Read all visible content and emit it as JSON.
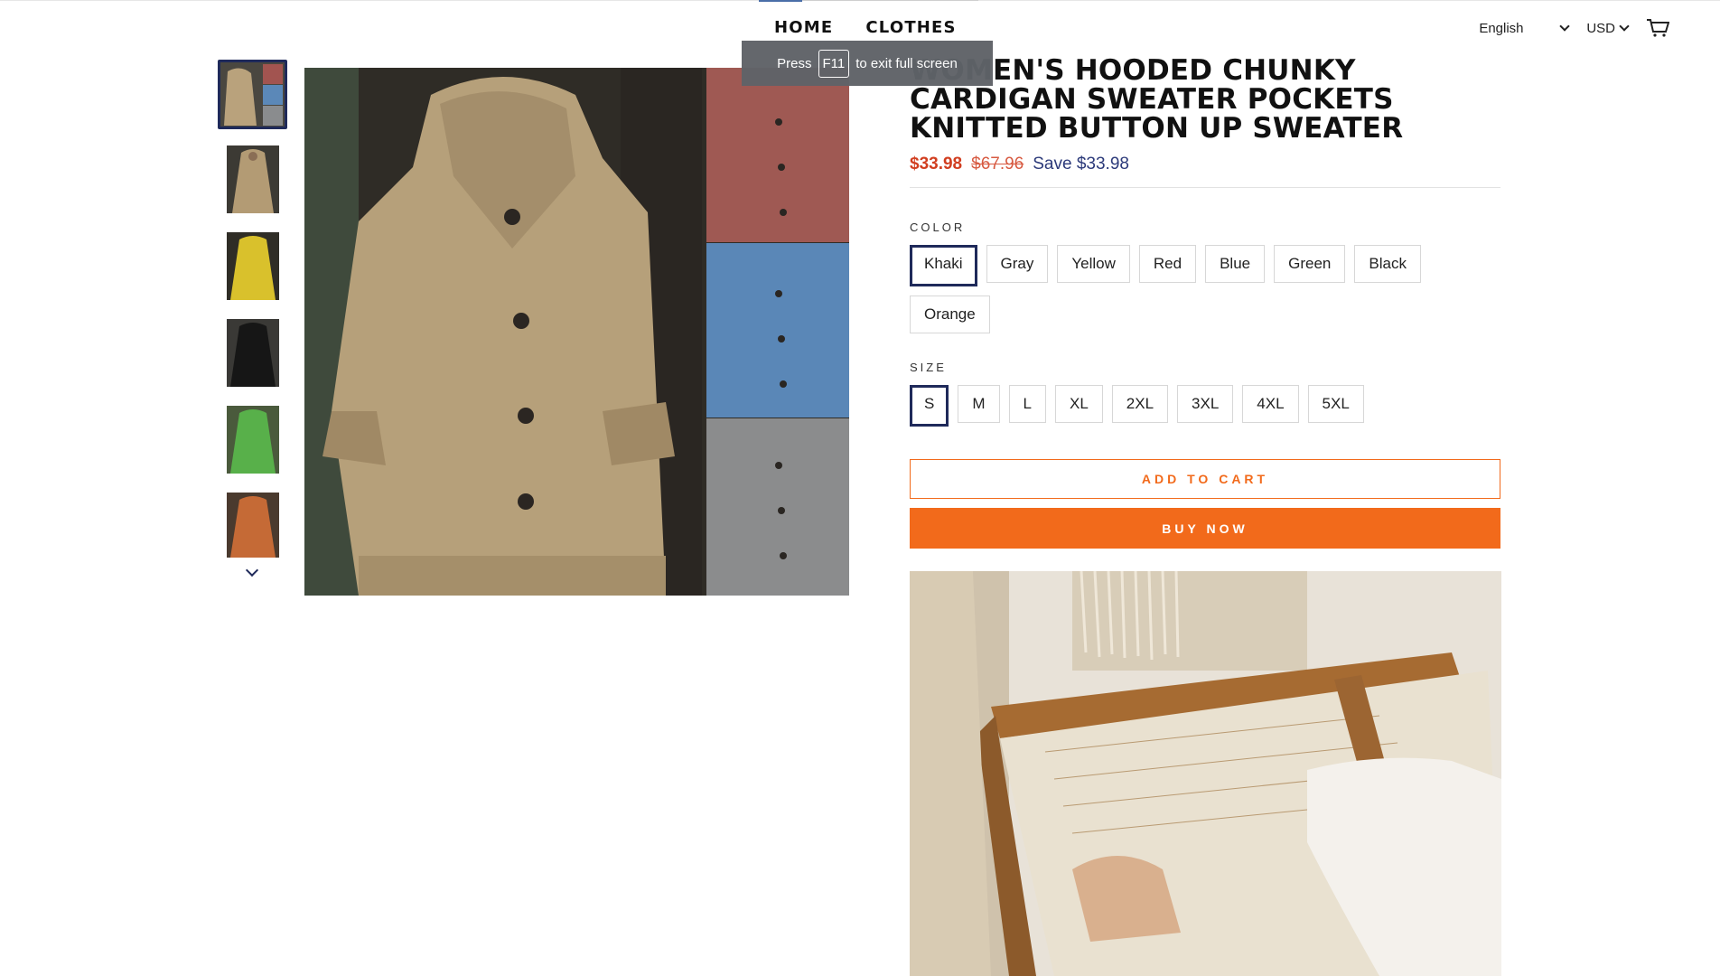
{
  "nav": {
    "items": [
      "HOME",
      "CLOTHES"
    ],
    "active": "HOME"
  },
  "header": {
    "language": "English",
    "currency": "USD",
    "cart_icon": "cart-icon"
  },
  "fullscreen_notice": {
    "prefix": "Press",
    "key": "F11",
    "suffix": "to exit full screen"
  },
  "product": {
    "title": "WOMEN'S HOODED CHUNKY CARDIGAN SWEATER POCKETS KNITTED BUTTON UP SWEATER",
    "price": "$33.98",
    "compare_price": "$67.96",
    "save": "Save $33.98",
    "color_label": "COLOR",
    "colors": [
      "Khaki",
      "Gray",
      "Yellow",
      "Red",
      "Blue",
      "Green",
      "Black",
      "Orange"
    ],
    "selected_color": "Khaki",
    "size_label": "SIZE",
    "sizes": [
      "S",
      "M",
      "L",
      "XL",
      "2XL",
      "3XL",
      "4XL",
      "5XL"
    ],
    "selected_size": "S",
    "add_to_cart": "ADD TO CART",
    "buy_now": "BUY NOW"
  },
  "thumbnails": [
    "khaki-collage",
    "khaki",
    "yellow",
    "black",
    "green",
    "orange"
  ],
  "colors": {
    "accent_orange": "#f26a1b",
    "price_red": "#d13e20",
    "selected_border": "#1f2a5a",
    "save_text": "#2c3a7a"
  }
}
